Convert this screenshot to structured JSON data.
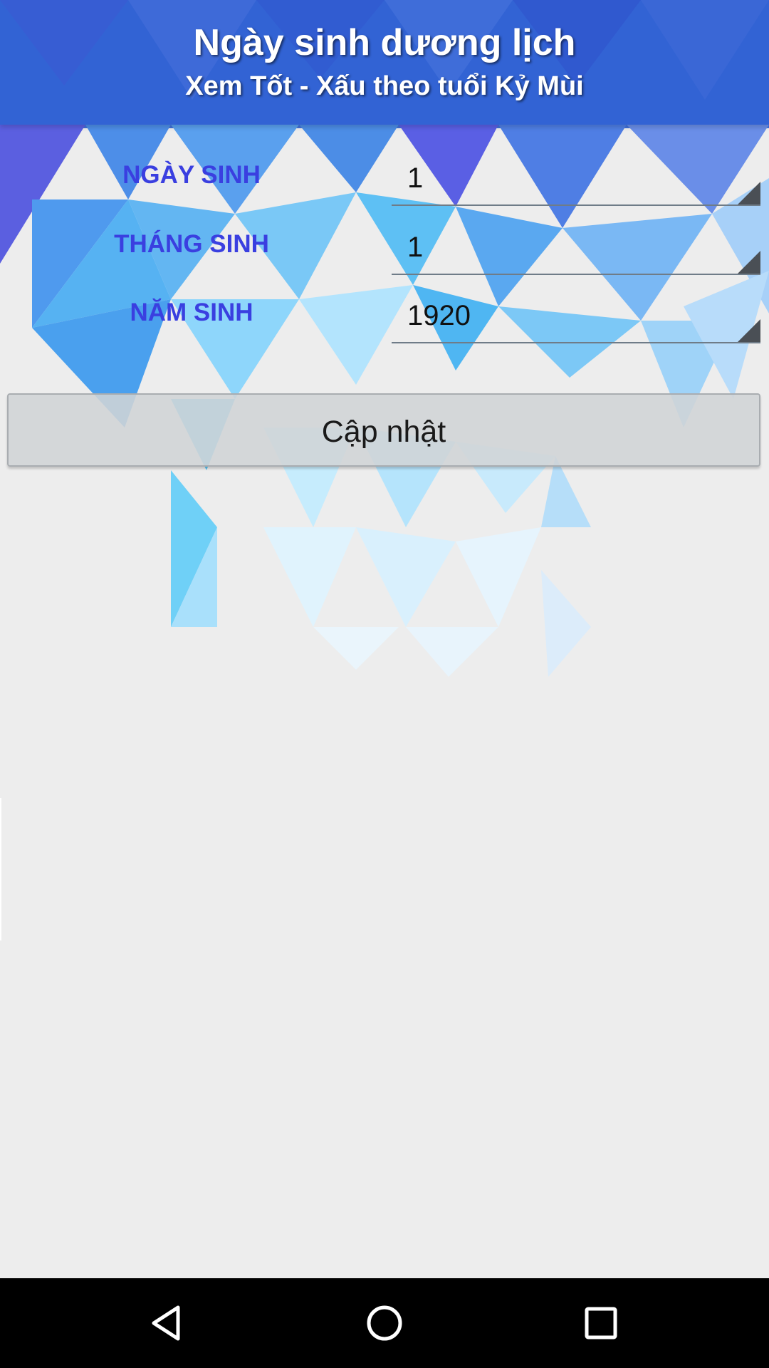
{
  "header": {
    "title": "Ngày sinh dương lịch",
    "subtitle": "Xem Tốt - Xấu theo tuổi Kỷ Mùi"
  },
  "form": {
    "day": {
      "label": "NGÀY SINH",
      "value": "1"
    },
    "month": {
      "label": "THÁNG SINH",
      "value": "1"
    },
    "year": {
      "label": "NĂM SINH",
      "value": "1920"
    }
  },
  "update_button": {
    "label": "Cập nhật"
  },
  "navigation": {
    "back_icon": "back-triangle-icon",
    "home_icon": "home-circle-icon",
    "recent_icon": "recent-apps-square-icon"
  },
  "colors": {
    "label_blue": "#3a3fe0",
    "header_overlay": "#285ad2",
    "background": "#ededed",
    "navbar": "#000000"
  }
}
